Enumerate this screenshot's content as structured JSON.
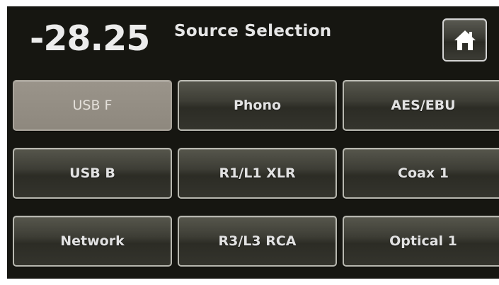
{
  "header": {
    "volume": "-28.25",
    "title": "Source Selection",
    "home_icon": "home-icon"
  },
  "colors": {
    "background": "#161611",
    "button_face": "#3e3e36",
    "button_border": "#b8b8b0",
    "selected_face": "#948e84",
    "text": "#e2e2e2"
  },
  "sources": [
    {
      "label": "USB F",
      "selected": true
    },
    {
      "label": "Phono",
      "selected": false
    },
    {
      "label": "AES/EBU",
      "selected": false
    },
    {
      "label": "USB B",
      "selected": false
    },
    {
      "label": "R1/L1 XLR",
      "selected": false
    },
    {
      "label": "Coax 1",
      "selected": false
    },
    {
      "label": "Network",
      "selected": false
    },
    {
      "label": "R3/L3 RCA",
      "selected": false
    },
    {
      "label": "Optical 1",
      "selected": false
    }
  ]
}
